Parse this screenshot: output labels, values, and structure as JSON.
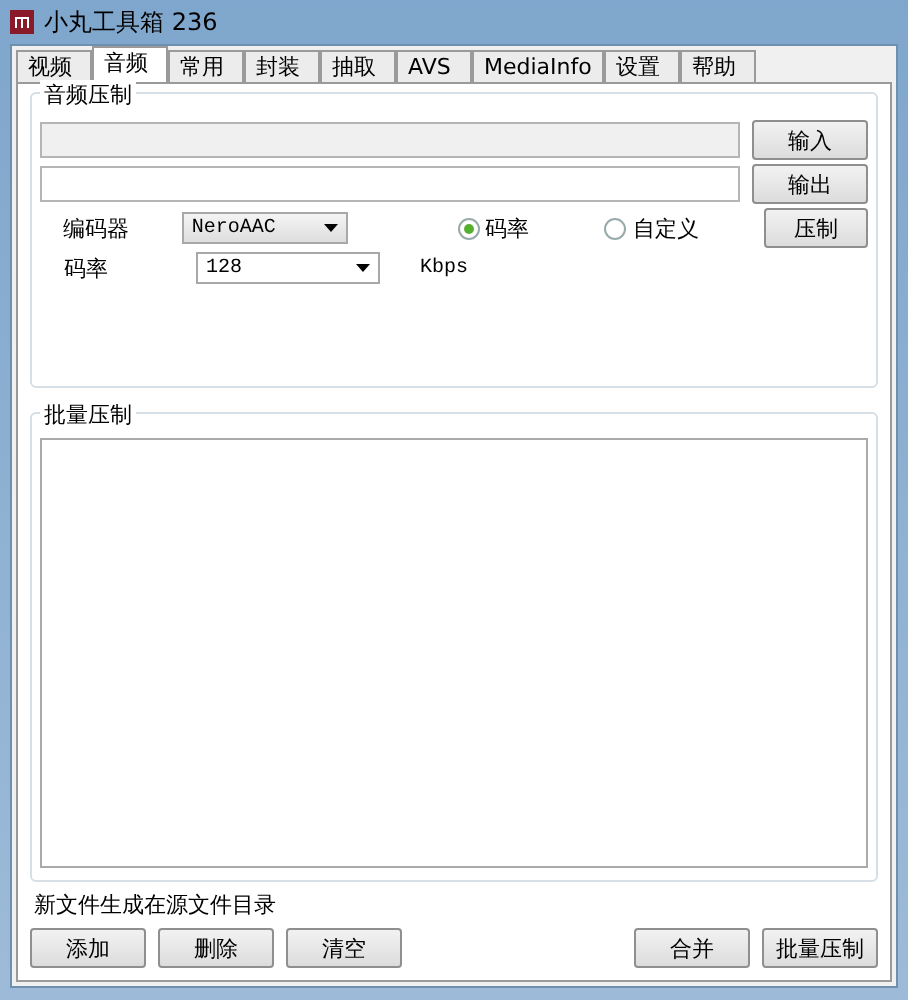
{
  "window": {
    "title": "小丸工具箱 236"
  },
  "tabs": [
    {
      "label": "视频",
      "selected": false
    },
    {
      "label": "音频",
      "selected": true
    },
    {
      "label": "常用",
      "selected": false
    },
    {
      "label": "封装",
      "selected": false
    },
    {
      "label": "抽取",
      "selected": false
    },
    {
      "label": "AVS",
      "selected": false
    },
    {
      "label": "MediaInfo",
      "selected": false
    },
    {
      "label": "设置",
      "selected": false
    },
    {
      "label": "帮助",
      "selected": false
    }
  ],
  "audio_group": {
    "title": "音频压制",
    "input_button": "输入",
    "output_button": "输出",
    "encoder_label": "编码器",
    "encoder_value": "NeroAAC",
    "bitrate_label": "码率",
    "bitrate_value": "128",
    "unit": "Kbps",
    "modes": [
      {
        "label": "码率",
        "selected": true
      },
      {
        "label": "自定义",
        "selected": false
      }
    ],
    "encode_button": "压制"
  },
  "batch_group": {
    "title": "批量压制"
  },
  "note": "新文件生成在源文件目录",
  "left_buttons": [
    "添加",
    "删除",
    "清空"
  ],
  "right_buttons": [
    "合并",
    "批量压制"
  ]
}
